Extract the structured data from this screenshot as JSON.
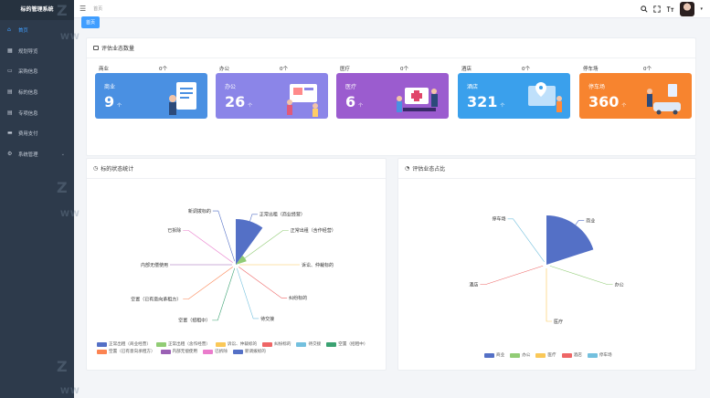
{
  "sidebar": {
    "brand": "标的管理系统",
    "items": [
      {
        "label": "首页",
        "icon": "home-icon",
        "active": true
      },
      {
        "label": "规划导览",
        "icon": "grid-icon"
      },
      {
        "label": "采购信息",
        "icon": "monitor-icon"
      },
      {
        "label": "标的信息",
        "icon": "doc-icon"
      },
      {
        "label": "专项信息",
        "icon": "doc-icon"
      },
      {
        "label": "费用支付",
        "icon": "card-icon"
      },
      {
        "label": "系统管理",
        "icon": "gear-icon",
        "expandable": true
      }
    ]
  },
  "header": {
    "breadcrumb": "首页",
    "tag": "首页"
  },
  "business_card": {
    "title": "评估业态数量",
    "captions": [
      {
        "name": "商业",
        "count": "0个"
      },
      {
        "name": "办公",
        "count": "0个"
      },
      {
        "name": "医疗",
        "count": "0个"
      },
      {
        "name": "酒店",
        "count": "0个"
      },
      {
        "name": "停车场",
        "count": "0个"
      }
    ],
    "tiles": [
      {
        "name": "商业",
        "value": "9",
        "unit": "个",
        "color": "#4a90e2"
      },
      {
        "name": "办公",
        "value": "26",
        "unit": "个",
        "color": "#8b85e8"
      },
      {
        "name": "医疗",
        "value": "6",
        "unit": "个",
        "color": "#9b5ccf"
      },
      {
        "name": "酒店",
        "value": "321",
        "unit": "个",
        "color": "#3aa0ec"
      },
      {
        "name": "停车场",
        "value": "360",
        "unit": "个",
        "color": "#f7842f"
      }
    ]
  },
  "status_chart": {
    "title": "标的状态统计",
    "chart_data": {
      "type": "pie",
      "style": "rose",
      "labels": [
        "正常出租（商业经营）",
        "正常出租（含作经营）",
        "诉讼、仲裁标的",
        "纠纷标的",
        "待交接",
        "空置（招租中）",
        "空置（已有意向承租方）",
        "内部无偿使用",
        "已拆除",
        "新调拨标的"
      ],
      "values": [
        28,
        4,
        0,
        0,
        0,
        0,
        0,
        0,
        0,
        0
      ],
      "colors": [
        "#5470c6",
        "#91cc75",
        "#fac858",
        "#ee6666",
        "#73c0de",
        "#3ba272",
        "#fc8452",
        "#9a60b4",
        "#ea7ccc",
        "#5470c6"
      ]
    }
  },
  "ratio_chart": {
    "title": "评估业态占比",
    "chart_data": {
      "type": "pie",
      "style": "rose",
      "labels": [
        "商业",
        "办公",
        "医疗",
        "酒店",
        "停车场"
      ],
      "values": [
        9,
        0,
        0,
        0,
        0
      ],
      "colors": [
        "#5470c6",
        "#91cc75",
        "#fac858",
        "#ee6666",
        "#73c0de"
      ]
    }
  },
  "watermark": {
    "mark": "Z",
    "text": "WW"
  }
}
